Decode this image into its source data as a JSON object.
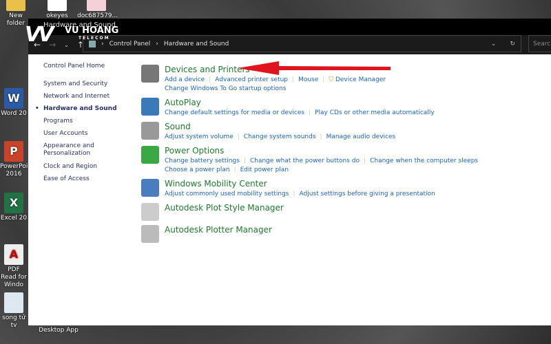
{
  "desktop": {
    "top_icons": [
      "New folder",
      "okeyes",
      "doc687579..."
    ],
    "left_icons": [
      "Word 20",
      "PowerPoi 2016",
      "Excel 20",
      "PDF Read for Windo",
      "song tử tv"
    ],
    "bottom_label": "Desktop App"
  },
  "watermark": {
    "brand": "VU HOANG",
    "sub": "TELECOM"
  },
  "window": {
    "title": "Hardware and Sound",
    "breadcrumb": [
      "Control Panel",
      "Hardware and Sound"
    ],
    "search_placeholder": "Search"
  },
  "left_nav": {
    "home": "Control Panel Home",
    "items": [
      "System and Security",
      "Network and Internet",
      "Hardware and Sound",
      "Programs",
      "User Accounts",
      "Appearance and Personalization",
      "Clock and Region",
      "Ease of Access"
    ],
    "current": "Hardware and Sound"
  },
  "categories": [
    {
      "title": "Devices and Printers",
      "icon": "printer-icon",
      "links": [
        [
          "Add a device",
          "Advanced printer setup",
          "Mouse",
          "Device Manager"
        ],
        [
          "Change Windows To Go startup options"
        ]
      ]
    },
    {
      "title": "AutoPlay",
      "icon": "autoplay-icon",
      "links": [
        [
          "Change default settings for media or devices",
          "Play CDs or other media automatically"
        ]
      ]
    },
    {
      "title": "Sound",
      "icon": "speaker-icon",
      "links": [
        [
          "Adjust system volume",
          "Change system sounds",
          "Manage audio devices"
        ]
      ]
    },
    {
      "title": "Power Options",
      "icon": "battery-icon",
      "links": [
        [
          "Change battery settings",
          "Change what the power buttons do",
          "Change when the computer sleeps"
        ],
        [
          "Choose a power plan",
          "Edit power plan"
        ]
      ]
    },
    {
      "title": "Windows Mobility Center",
      "icon": "laptop-icon",
      "links": [
        [
          "Adjust commonly used mobility settings",
          "Adjust settings before giving a presentation"
        ]
      ]
    },
    {
      "title": "Autodesk Plot Style Manager",
      "icon": "plot-style-icon",
      "links": []
    },
    {
      "title": "Autodesk Plotter Manager",
      "icon": "plotter-icon",
      "links": []
    }
  ],
  "colors": {
    "category": "#1e7a2e",
    "link": "#1a64c8",
    "arrow": "#e0141e"
  }
}
